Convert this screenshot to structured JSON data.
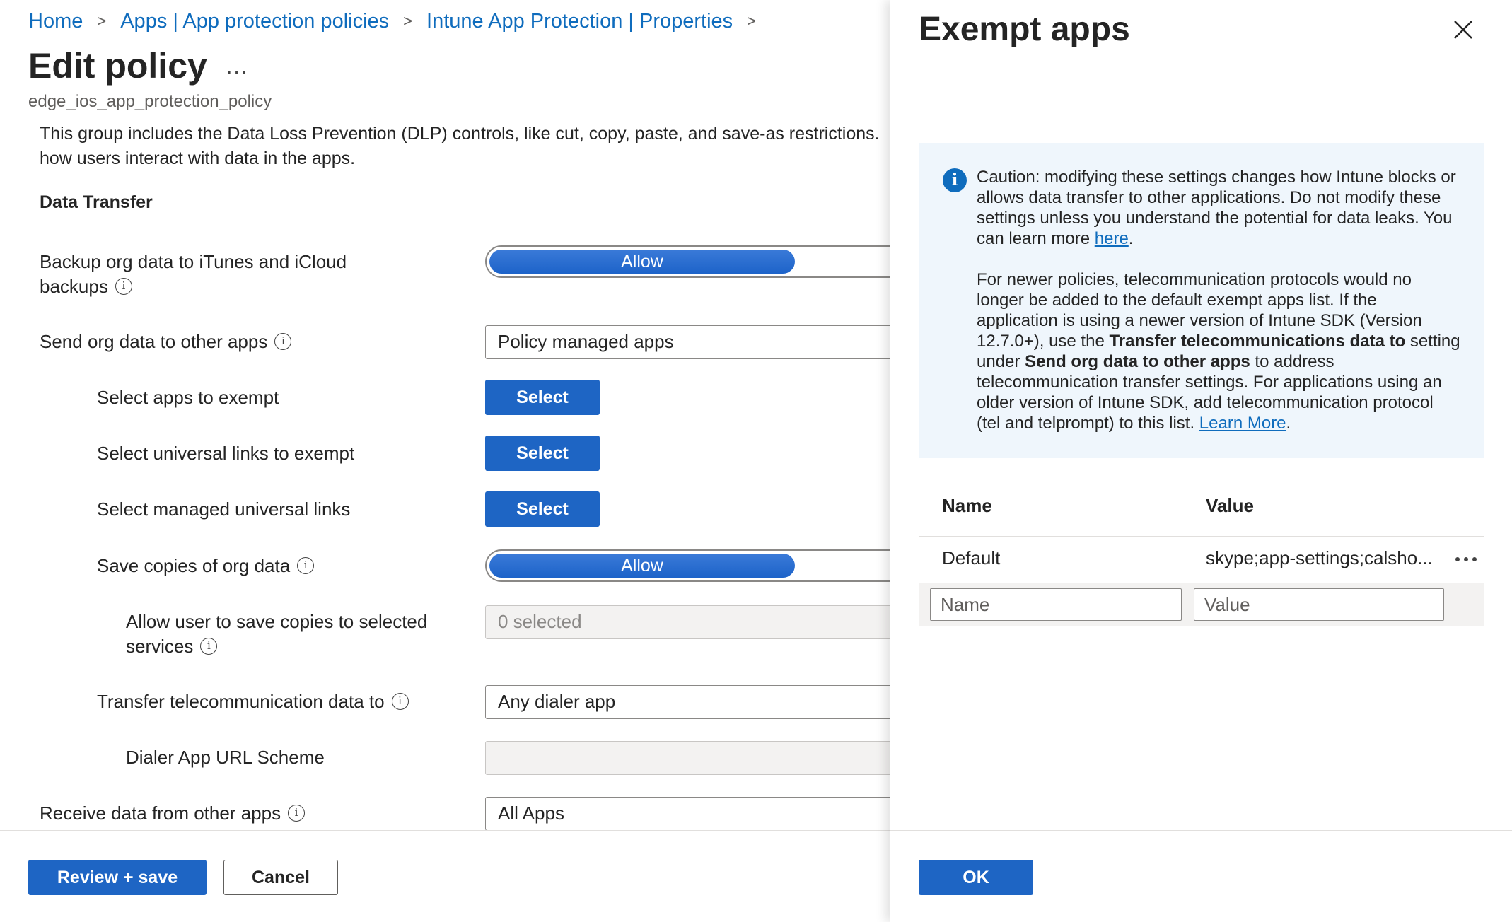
{
  "breadcrumb": {
    "items": [
      "Home",
      "Apps | App protection policies",
      "Intune App Protection | Properties"
    ],
    "separator": ">"
  },
  "page": {
    "title": "Edit policy",
    "more": "...",
    "subtitle": "edge_ios_app_protection_policy",
    "description": "This group includes the Data Loss Prevention (DLP) controls, like cut, copy, paste, and save-as restrictions. how users interact with data in the apps.",
    "section": "Data Transfer"
  },
  "settings": {
    "backup": {
      "label_line1": "Backup org data to iTunes and iCloud",
      "label_line2": "backups",
      "value": "Allow"
    },
    "send": {
      "label": "Send org data to other apps",
      "value": "Policy managed apps"
    },
    "exempt_apps": {
      "label": "Select apps to exempt",
      "button": "Select"
    },
    "exempt_links": {
      "label": "Select universal links to exempt",
      "button": "Select"
    },
    "managed_links": {
      "label": "Select managed universal links",
      "button": "Select"
    },
    "save_copies": {
      "label": "Save copies of org data",
      "value": "Allow"
    },
    "save_services": {
      "label_line1": "Allow user to save copies to selected",
      "label_line2": "services",
      "value": "0 selected"
    },
    "telecom": {
      "label": "Transfer telecommunication data to",
      "value": "Any dialer app"
    },
    "dialer_scheme": {
      "label": "Dialer App URL Scheme",
      "value": ""
    },
    "receive": {
      "label": "Receive data from other apps",
      "value": "All Apps"
    }
  },
  "footer": {
    "review_save": "Review + save",
    "cancel": "Cancel"
  },
  "panel": {
    "title": "Exempt apps",
    "info": {
      "p1_text": "Caution: modifying these settings changes how Intune blocks or allows data transfer to other applications. Do not modify these settings unless you understand the potential for data leaks. You can learn more ",
      "p1_link": "here",
      "p1_end": ".",
      "p2_a": "For newer policies, telecommunication protocols would no longer be added to the default exempt apps list. If the application is using a newer version of Intune SDK (Version 12.7.0+), use the ",
      "p2_bold1": "Transfer telecommunications data to",
      "p2_b": " setting under ",
      "p2_bold2": "Send org data to other apps",
      "p2_c": " to address telecommunication transfer settings. For applications using an older version of Intune SDK, add telecommunication protocol (tel and telprompt) to this list. ",
      "p2_link": "Learn More",
      "p2_end": "."
    },
    "table": {
      "col_name": "Name",
      "col_value": "Value",
      "rows": [
        {
          "name": "Default",
          "value": "skype;app-settings;calsho..."
        }
      ],
      "name_placeholder": "Name",
      "value_placeholder": "Value"
    },
    "ok": "OK"
  }
}
